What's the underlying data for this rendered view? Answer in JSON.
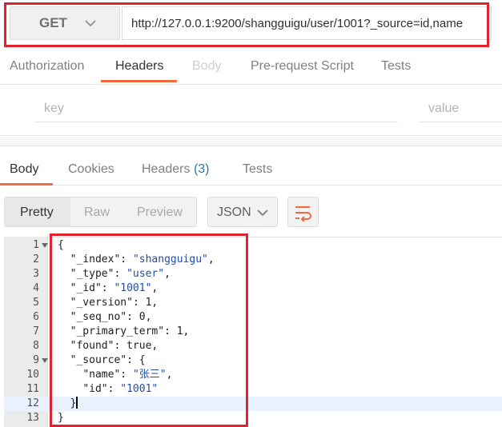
{
  "request": {
    "method": "GET",
    "url": "http://127.0.0.1:9200/shangguigu/user/1001?_source=id,name"
  },
  "request_tabs": [
    {
      "label": "Authorization",
      "state": "normal"
    },
    {
      "label": "Headers",
      "state": "active"
    },
    {
      "label": "Body",
      "state": "disabled"
    },
    {
      "label": "Pre-request Script",
      "state": "normal"
    },
    {
      "label": "Tests",
      "state": "normal"
    }
  ],
  "headers_row": {
    "key_placeholder": "key",
    "value_placeholder": "value"
  },
  "response_tabs": {
    "body": "Body",
    "cookies": "Cookies",
    "headers": "Headers",
    "headers_count": "(3)",
    "tests": "Tests"
  },
  "toolbar": {
    "pretty": "Pretty",
    "raw": "Raw",
    "preview": "Preview",
    "language": "JSON",
    "wrap_icon": "wrap-lines-icon"
  },
  "colors": {
    "accent": "#f26b3a",
    "highlight_box": "#e0232f",
    "string": "#1f4ea6",
    "link_count": "#2a7ab0"
  },
  "code_lines": [
    {
      "num": "1",
      "fold": true,
      "text": "{"
    },
    {
      "num": "2",
      "fold": false,
      "text": "  \"_index\": \"shangguigu\","
    },
    {
      "num": "3",
      "fold": false,
      "text": "  \"_type\": \"user\","
    },
    {
      "num": "4",
      "fold": false,
      "text": "  \"_id\": \"1001\","
    },
    {
      "num": "5",
      "fold": false,
      "text": "  \"_version\": 1,"
    },
    {
      "num": "6",
      "fold": false,
      "text": "  \"_seq_no\": 0,"
    },
    {
      "num": "7",
      "fold": false,
      "text": "  \"_primary_term\": 1,"
    },
    {
      "num": "8",
      "fold": false,
      "text": "  \"found\": true,"
    },
    {
      "num": "9",
      "fold": true,
      "text": "  \"_source\": {"
    },
    {
      "num": "10",
      "fold": false,
      "text": "    \"name\": \"张三\","
    },
    {
      "num": "11",
      "fold": false,
      "text": "    \"id\": \"1001\""
    },
    {
      "num": "12",
      "fold": false,
      "text": "  }"
    },
    {
      "num": "13",
      "fold": false,
      "text": "}"
    }
  ],
  "active_line": "12"
}
